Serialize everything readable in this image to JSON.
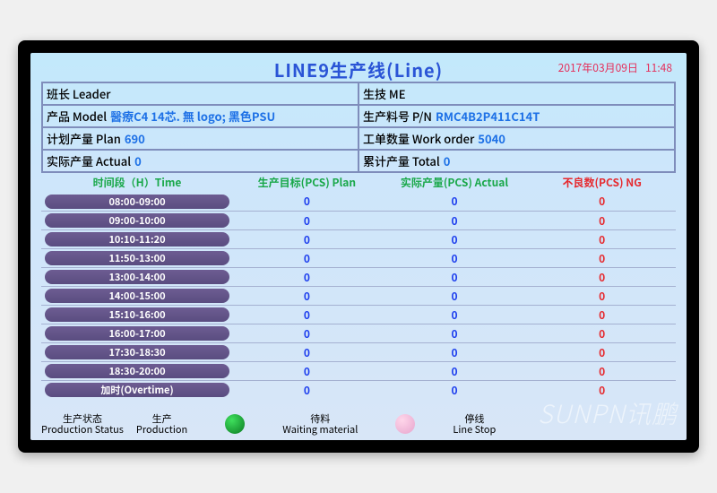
{
  "title": "LINE9生产线(Line)",
  "datetime": {
    "date": "2017年03月09日",
    "time": "11:48"
  },
  "info": {
    "leader_label": "班长 Leader",
    "leader_value": "",
    "me_label": "生技 ME",
    "me_value": "",
    "model_label": "产品 Model",
    "model_value": "醫療C4 14芯. 無 logo; 黑色PSU",
    "pn_label": "生产料号 P/N",
    "pn_value": "RMC4B2P411C14T",
    "plan_label": "计划产量 Plan",
    "plan_value": "690",
    "wo_label": "工单数量 Work order",
    "wo_value": "5040",
    "actual_label": "实际产量 Actual",
    "actual_value": "0",
    "total_label": "累计产量 Total",
    "total_value": "0"
  },
  "headers": {
    "time": "时间段（H）Time",
    "plan": "生产目标(PCS) Plan",
    "actual": "实际产量(PCS) Actual",
    "ng": "不良数(PCS) NG"
  },
  "rows": [
    {
      "time": "08:00-09:00",
      "plan": "0",
      "actual": "0",
      "ng": "0"
    },
    {
      "time": "09:00-10:00",
      "plan": "0",
      "actual": "0",
      "ng": "0"
    },
    {
      "time": "10:10-11:20",
      "plan": "0",
      "actual": "0",
      "ng": "0"
    },
    {
      "time": "11:50-13:00",
      "plan": "0",
      "actual": "0",
      "ng": "0"
    },
    {
      "time": "13:00-14:00",
      "plan": "0",
      "actual": "0",
      "ng": "0"
    },
    {
      "time": "14:00-15:00",
      "plan": "0",
      "actual": "0",
      "ng": "0"
    },
    {
      "time": "15:10-16:00",
      "plan": "0",
      "actual": "0",
      "ng": "0"
    },
    {
      "time": "16:00-17:00",
      "plan": "0",
      "actual": "0",
      "ng": "0"
    },
    {
      "time": "17:30-18:30",
      "plan": "0",
      "actual": "0",
      "ng": "0"
    },
    {
      "time": "18:30-20:00",
      "plan": "0",
      "actual": "0",
      "ng": "0"
    },
    {
      "time": "加时(Overtime)",
      "plan": "0",
      "actual": "0",
      "ng": "0"
    }
  ],
  "status": {
    "label_cn": "生产状态",
    "label_en": "Production Status",
    "prod_cn": "生产",
    "prod_en": "Production",
    "wait_cn": "待料",
    "wait_en": "Waiting material",
    "stop_cn": "停线",
    "stop_en": "Line Stop"
  },
  "watermark": "SUNPN讯鹏"
}
